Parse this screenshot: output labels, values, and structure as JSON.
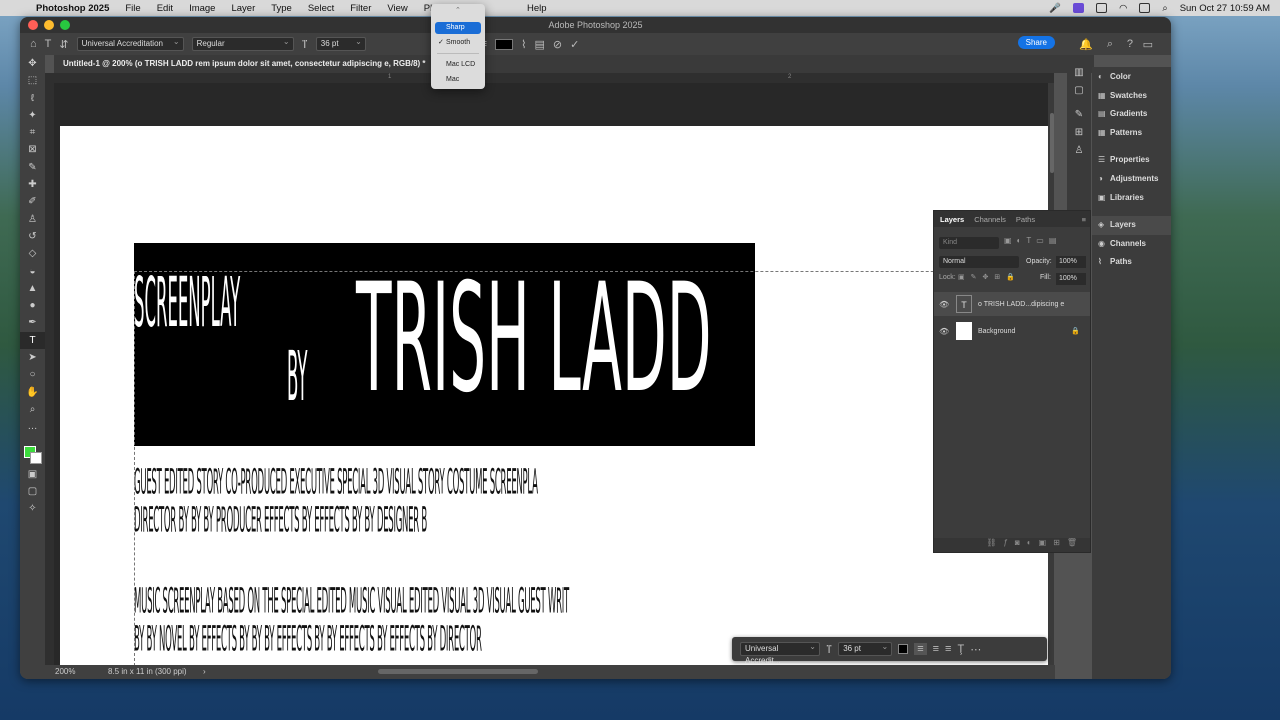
{
  "mac_menu": {
    "app": "Photoshop 2025",
    "items": [
      "File",
      "Edit",
      "Image",
      "Layer",
      "Type",
      "Select",
      "Filter",
      "View",
      "Plugins",
      "Help"
    ],
    "clock": "Sun Oct 27  10:59 AM"
  },
  "window_title": "Adobe Photoshop 2025",
  "options_bar": {
    "font_family": "Universal Accreditation",
    "font_style": "Regular",
    "font_size": "36 pt",
    "share_label": "Share"
  },
  "antialias_menu": {
    "options": [
      "Sharp",
      "Smooth",
      "Mac LCD",
      "Mac"
    ],
    "hovered": "Sharp",
    "checked": "Smooth",
    "checkmark": "✓",
    "up_arrow": "⌃"
  },
  "document_tab": "Untitled-1 @ 200% (o TRISH LADD rem ipsum dolor sit amet, consectetur adipiscing e, RGB/8) *",
  "ruler": {
    "mark_1": "1",
    "mark_2": "2"
  },
  "canvas": {
    "screenplay": "SCREENPLAY",
    "by": "BY",
    "name": "TRISH LADD",
    "row1": "GUEST EDITED STORY   CO-PRODUCED  EXECUTIVE     SPECIAL  3D VISUAL STORY    COSTUME SCREENPLA",
    "row2": "DIRECTOR       BY       BY                    BY PRODUCER EFFECTS BY EFFECTS BY      BY   DESIGNER                   B",
    "row3": "MUSIC SCREENPLAY BASED ON THE     SPECIAL EDITED MUSIC      VISUAL EDITED       VISUAL  3D VISUAL       GUEST   WRIT",
    "row4": "     BY                BY         NOVEL BY EFFECTS BY       BY      BY EFFECTS BY      BY EFFECTS BY EFFECTS BY DIRECTOR"
  },
  "status": {
    "zoom": "200%",
    "doc_info": "8.5 in x 11 in (300 ppi)",
    "arrow": "›"
  },
  "float_bar": {
    "font": "Universal Accredit...",
    "size": "36 pt"
  },
  "right_panels": [
    "Color",
    "Swatches",
    "Gradients",
    "Patterns",
    "Properties",
    "Adjustments",
    "Libraries",
    "Layers",
    "Channels",
    "Paths"
  ],
  "layers_panel": {
    "tabs": [
      "Layers",
      "Channels",
      "Paths"
    ],
    "filter_placeholder": "Kind",
    "blend_mode": "Normal",
    "opacity_label": "Opacity:",
    "opacity": "100%",
    "lock_label": "Lock:",
    "fill_label": "Fill:",
    "fill": "100%",
    "layers": [
      {
        "name": "o TRISH LADD...dipiscing e",
        "type": "text"
      },
      {
        "name": "Background",
        "type": "pixel"
      }
    ]
  }
}
